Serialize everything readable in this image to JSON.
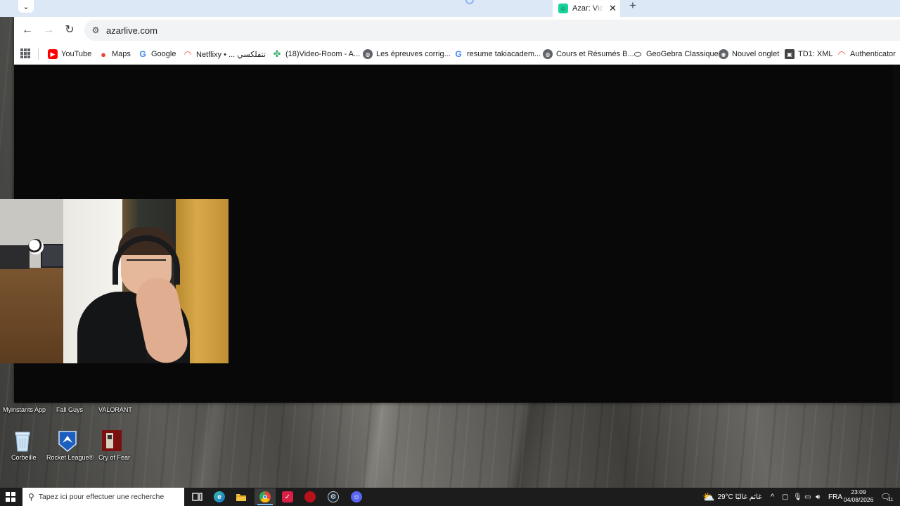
{
  "browser": {
    "tab": {
      "title": "Azar: Vid",
      "close_glyph": "✕"
    },
    "new_tab_glyph": "+",
    "tab_search_glyph": "⌄",
    "back_glyph": "←",
    "forward_glyph": "→",
    "reload_glyph": "↻",
    "site_info_glyph": "⚙",
    "url": "azarlive.com",
    "bookmarks": [
      {
        "label": "YouTube",
        "icon": "youtube-icon"
      },
      {
        "label": "Maps",
        "icon": "maps-icon"
      },
      {
        "label": "Google",
        "icon": "google-icon"
      },
      {
        "label": "Netflixy • ... تتفلكسي",
        "icon": "netflixy-icon"
      },
      {
        "label": "(18)Video-Room - A...",
        "icon": "video-room-icon"
      },
      {
        "label": "Les épreuves corrig...",
        "icon": "globe-icon"
      },
      {
        "label": "resume takiacadem...",
        "icon": "google-icon"
      },
      {
        "label": "Cours et Résumés B...",
        "icon": "globe-icon"
      },
      {
        "label": "GeoGebra Classique",
        "icon": "geogebra-icon"
      },
      {
        "label": "Nouvel onglet",
        "icon": "chrome-icon"
      },
      {
        "label": "TD1: XML",
        "icon": "document-icon"
      },
      {
        "label": "Authenticator",
        "icon": "authenticator-icon"
      }
    ]
  },
  "desktop": {
    "icons_row1": [
      "Myinstants App",
      "Fall Guys",
      "VALORANT"
    ],
    "icons_row2": [
      "Corbeille",
      "Rocket League®",
      "Cry of Fear"
    ]
  },
  "taskbar": {
    "search_placeholder": "Tapez ici pour effectuer une recherche",
    "weather": "29°C  غائم غالبًا",
    "language": "FRA",
    "time": "23:09",
    "date": "04/08/2026",
    "notification_count": "11",
    "tray_chevron": "^"
  },
  "colors": {
    "tabstrip": "#dde8f7",
    "page_bg": "#080808",
    "taskbar": "#1c1c1c",
    "azar_green": "#19d49a"
  }
}
